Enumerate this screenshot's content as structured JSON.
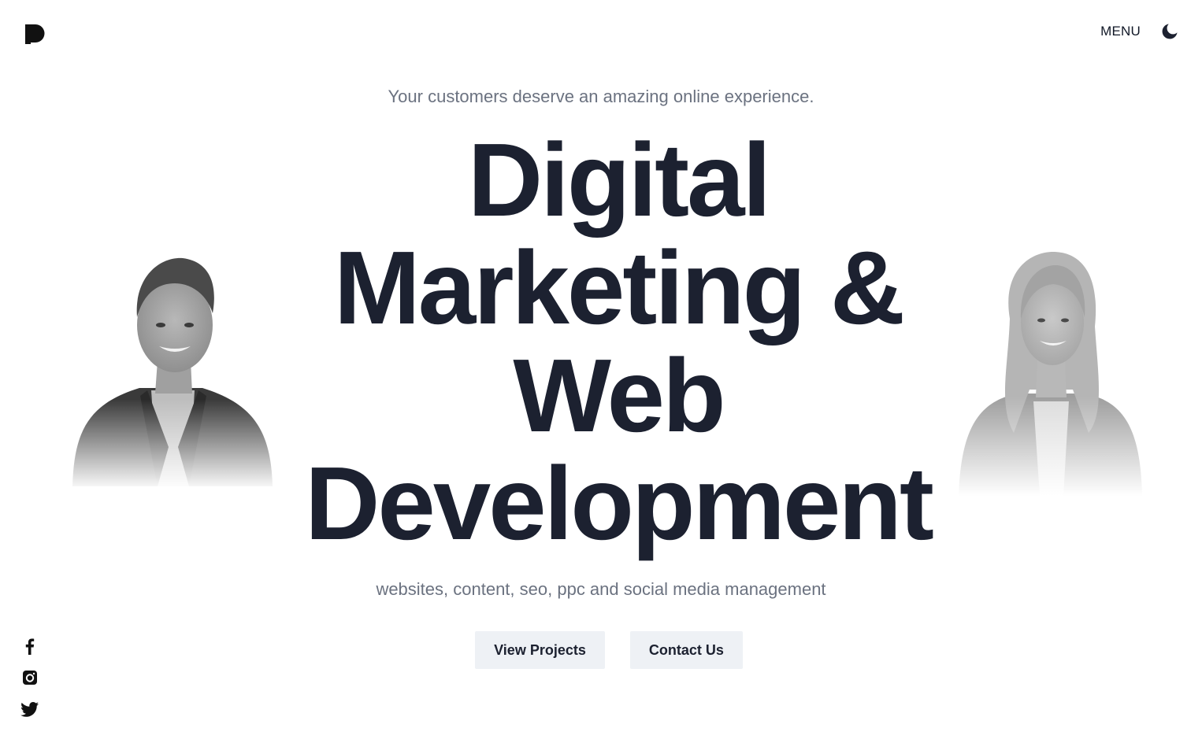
{
  "header": {
    "logo_icon": "p-logo-icon",
    "menu_label": "MENU",
    "theme_toggle_icon": "moon-icon"
  },
  "hero": {
    "tagline": "Your customers deserve an amazing online experience.",
    "headline_lines": [
      "Digital",
      "Marketing &",
      "Web",
      "Development"
    ],
    "subline": "websites, content, seo, ppc and social media management",
    "buttons": {
      "view_projects": "View Projects",
      "contact_us": "Contact Us"
    }
  },
  "portraits": {
    "left_icon": "man-portrait-photo",
    "right_icon": "woman-portrait-photo"
  },
  "social": {
    "icons": [
      "facebook-icon",
      "instagram-icon",
      "twitter-icon"
    ]
  },
  "colors": {
    "text_dark": "#1c2130",
    "text_muted": "#6b7280",
    "button_bg": "#eef1f5",
    "background": "#ffffff"
  }
}
